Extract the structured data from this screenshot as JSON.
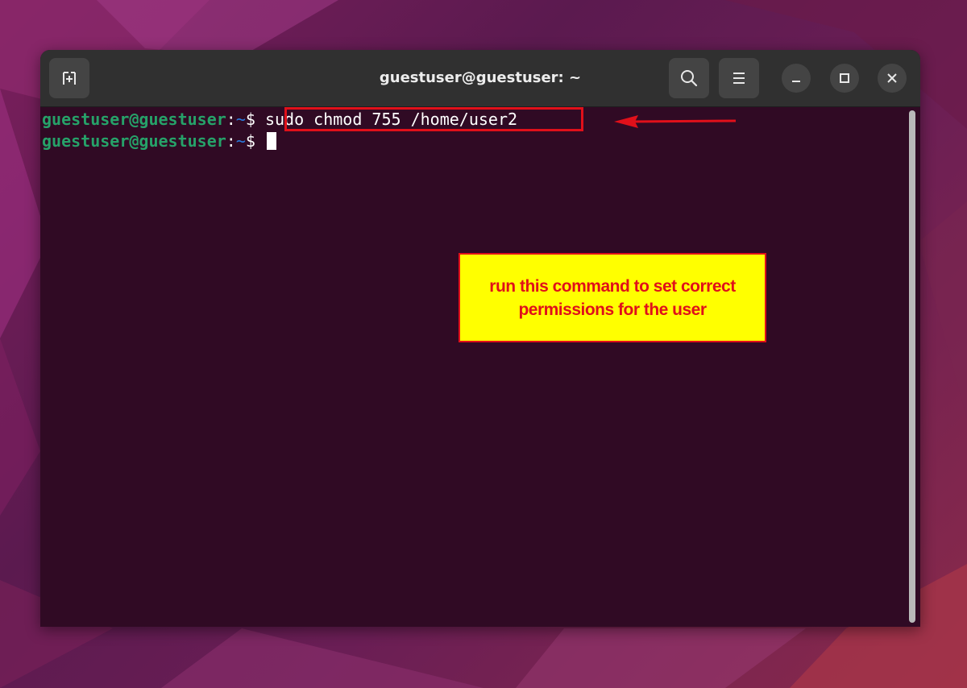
{
  "window": {
    "title": "guestuser@guestuser: ~"
  },
  "icons": {
    "new_tab": "new-tab-icon",
    "search": "search-icon",
    "menu": "hamburger-menu-icon",
    "minimize": "minimize-icon",
    "maximize": "maximize-icon",
    "close": "close-icon"
  },
  "terminal": {
    "lines": [
      {
        "user_host": "guestuser@guestuser",
        "colon": ":",
        "path": "~",
        "prompt": "$",
        "command": "sudo chmod 755 /home/user2"
      },
      {
        "user_host": "guestuser@guestuser",
        "colon": ":",
        "path": "~",
        "prompt": "$",
        "command": ""
      }
    ]
  },
  "annotation": {
    "callout_text": "run this command to set correct permissions for the user"
  },
  "colors": {
    "terminal_bg": "#300a24",
    "prompt_user": "#26a269",
    "prompt_path": "#2a7bde",
    "annotation_red": "#e0101a",
    "callout_yellow": "#ffff00"
  }
}
